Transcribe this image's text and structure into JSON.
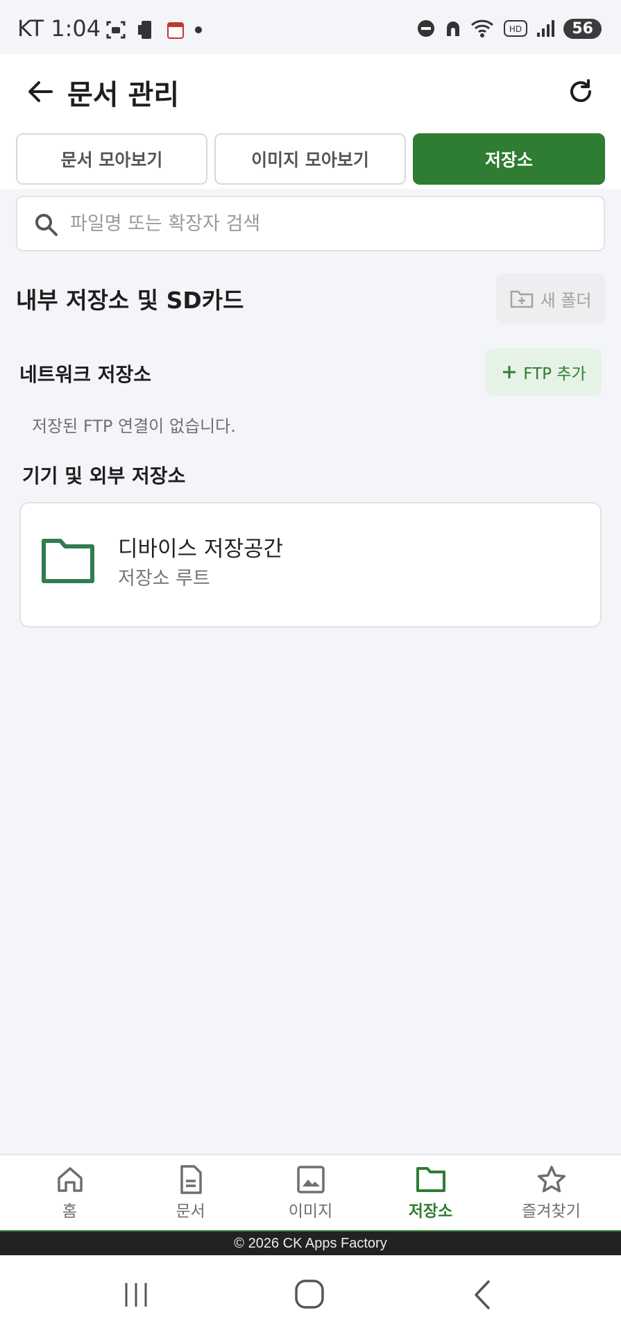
{
  "status_bar": {
    "time": "KT 1:04",
    "battery": "56"
  },
  "header": {
    "title": "문서 관리"
  },
  "tabs": [
    {
      "label": "문서 모아보기",
      "active": false
    },
    {
      "label": "이미지 모아보기",
      "active": false
    },
    {
      "label": "저장소",
      "active": true
    }
  ],
  "search": {
    "placeholder": "파일명 또는 확장자 검색",
    "value": ""
  },
  "internal_section": {
    "title": "내부 저장소 및 SD카드",
    "new_folder_label": "새 폴더"
  },
  "network_section": {
    "title": "네트워크 저장소",
    "add_ftp_label": "FTP 추가",
    "empty_message": "저장된 FTP 연결이 없습니다."
  },
  "device_section": {
    "title": "기기 및 외부 저장소",
    "items": [
      {
        "title": "디바이스 저장공간",
        "subtitle": "저장소 루트"
      }
    ]
  },
  "bottom_nav": {
    "items": [
      {
        "label": "홈",
        "icon": "home-icon"
      },
      {
        "label": "문서",
        "icon": "document-icon"
      },
      {
        "label": "이미지",
        "icon": "image-icon"
      },
      {
        "label": "저장소",
        "icon": "folder-icon",
        "active": true
      },
      {
        "label": "즐겨찾기",
        "icon": "star-icon"
      }
    ]
  },
  "footer": {
    "text": "© 2026 CK Apps Factory"
  },
  "colors": {
    "accent": "#2e7d32",
    "background": "#f3f5f8"
  }
}
